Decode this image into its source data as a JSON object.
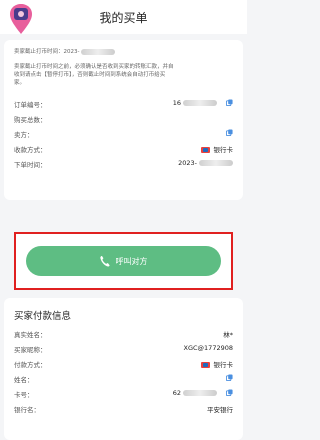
{
  "header": {
    "title": "我的买单"
  },
  "order": {
    "notice_line1_label": "卖家截止打币时间：2023-",
    "notice_line2_prefix": "卖家截止打币时间之前，必须确认是否收到买家的转账汇款，并自",
    "notice_line2_mid": "收到请点击【暂停打币】，否则截止时间到系统会自动打币给买",
    "notice_line2_end": "家。",
    "rows": [
      {
        "label": "订单编号：",
        "value": "16",
        "copy": true
      },
      {
        "label": "购买总数：",
        "value": "",
        "copy": false
      },
      {
        "label": "卖方：",
        "value": "",
        "copy": true
      },
      {
        "label": "收款方式：",
        "value": "银行卡",
        "copy": false,
        "bank": true
      },
      {
        "label": "下单时间：",
        "value": "2023-",
        "copy": false
      }
    ]
  },
  "call": {
    "label": "呼叫对方",
    "color": "#5ebd83"
  },
  "payer": {
    "title": "买家付款信息",
    "rows": [
      {
        "label": "真实姓名：",
        "value": "林*",
        "copy": false
      },
      {
        "label": "买家昵称：",
        "value": "XGC@1772908",
        "copy": false
      },
      {
        "label": "付款方式：",
        "value": "银行卡",
        "copy": false,
        "bank": true
      },
      {
        "label": "姓名：",
        "value": "",
        "copy": true
      },
      {
        "label": "卡号：",
        "value": "62",
        "copy": true
      },
      {
        "label": "银行名：",
        "value": "平安银行",
        "copy": false
      }
    ]
  },
  "colors": {
    "accent_green": "#5ebd83",
    "highlight_red": "#e02020",
    "warning_red": "#e04a3d"
  },
  "icons": {
    "logo": "app-logo-icon",
    "copy": "copy-icon",
    "phone": "phone-icon",
    "bank": "unionpay-icon"
  }
}
